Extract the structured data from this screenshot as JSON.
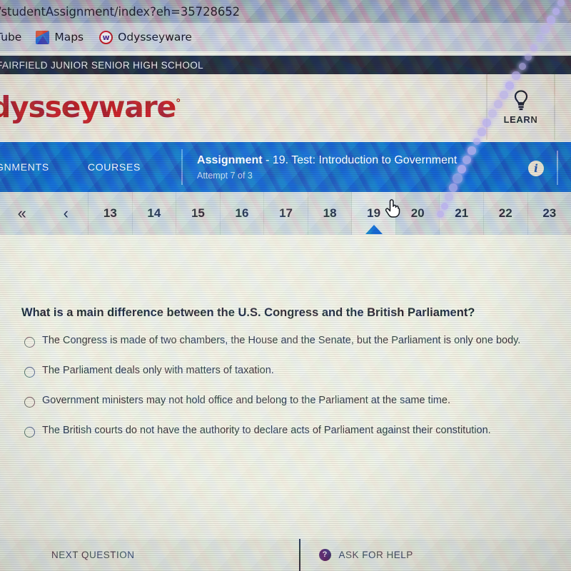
{
  "browser": {
    "url": "/studentAssignment/index?eh=35728652",
    "bookmarks": [
      {
        "label": "Tube",
        "icon": "youtube-icon"
      },
      {
        "label": "Maps",
        "icon": "maps-icon"
      },
      {
        "label": "Odysseyware",
        "icon": "odysseyware-icon"
      }
    ]
  },
  "school_bar": {
    "name": "FAIRFIELD JUNIOR SENIOR HIGH SCHOOL"
  },
  "header": {
    "logo_text": "dysseyware",
    "logo_mark": "°",
    "learn_label": "LEARN",
    "learn_icon": "lightbulb-icon",
    "brand_color": "#b01f28"
  },
  "nav": {
    "assignments_label": "GNMENTS",
    "courses_label": "COURSES",
    "assignment_word": "Assignment",
    "assignment_title": " - 19. Test: Introduction to Government",
    "attempt": "Attempt 7 of 3",
    "info_icon": "info-icon",
    "info_glyph": "i",
    "bar_color": "#1460c4"
  },
  "pager": {
    "first_glyph": "«",
    "prev_glyph": "‹",
    "pages": [
      "13",
      "14",
      "15",
      "16",
      "17",
      "18",
      "19",
      "20",
      "21",
      "22",
      "23"
    ],
    "active_page": "19",
    "hovered_page": "20",
    "marker_color": "#0f62c8"
  },
  "question": {
    "text": "What is a main difference between the U.S. Congress and the British Parliament?",
    "options": [
      "The Congress is made of two chambers, the House and the Senate, but the Parliament is only one body.",
      "The Parliament deals only with matters of taxation.",
      "Government ministers may not hold office and belong to the Parliament at the same time.",
      "The British courts do not have the authority to declare acts of Parliament against their constitution."
    ]
  },
  "footer": {
    "next_label": "NEXT QUESTION",
    "help_label": "ASK FOR HELP",
    "help_icon": "question-mark-icon",
    "help_glyph": "?"
  },
  "cursor": {
    "type": "pointing-hand-cursor"
  }
}
